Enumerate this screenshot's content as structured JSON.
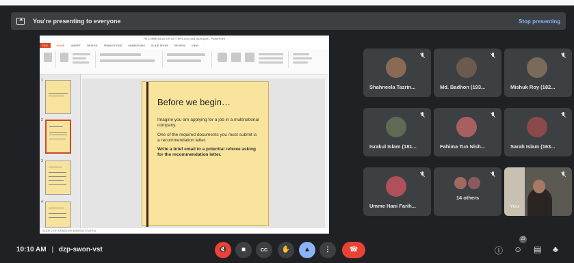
{
  "banner": {
    "text": "You're presenting to everyone",
    "stop": "Stop presenting"
  },
  "ppt": {
    "title": "RECOMMENDATION LETTERS.docx and dsum.pptx - PowerPoint",
    "tabs": [
      "FILE",
      "HOME",
      "INSERT",
      "DESIGN",
      "TRANSITIONS",
      "ANIMATIONS",
      "SLIDE SHOW",
      "REVIEW",
      "VIEW"
    ],
    "thumb_numbers": [
      "1",
      "2",
      "3",
      "4"
    ],
    "status": "SLIDE 2 OF 8   ENGLISH (UNITED STATES)",
    "slide": {
      "heading": "Before we begin…",
      "p1": "Imagine you are applying for a job in a multinational company.",
      "p2": "One of the required documents you must submit is a recommendation letter.",
      "p3": "Write a brief email to a potential referee asking for the recommendation letter."
    }
  },
  "participants": [
    {
      "name": "Shahneela Tazrin...",
      "color": "#8a6a55"
    },
    {
      "name": "Md. Badhon (193...",
      "color": "#6b5a4e"
    },
    {
      "name": "Mishuk Roy (182...",
      "color": "#7a6a5a"
    },
    {
      "name": "Israkul Islam (181...",
      "color": "#5f6a55"
    },
    {
      "name": "Fahima Tun Nish...",
      "color": "#a7605f"
    },
    {
      "name": "Sarah Islam (163...",
      "color": "#8a4a4a"
    },
    {
      "name": "Umme Hani Farih...",
      "color": "#b0505a"
    }
  ],
  "others": "14 others",
  "self_label": "You",
  "meeting": {
    "time": "10:10 AM",
    "code": "dzp-swon-vst",
    "separator": "|"
  },
  "people_count": "23"
}
